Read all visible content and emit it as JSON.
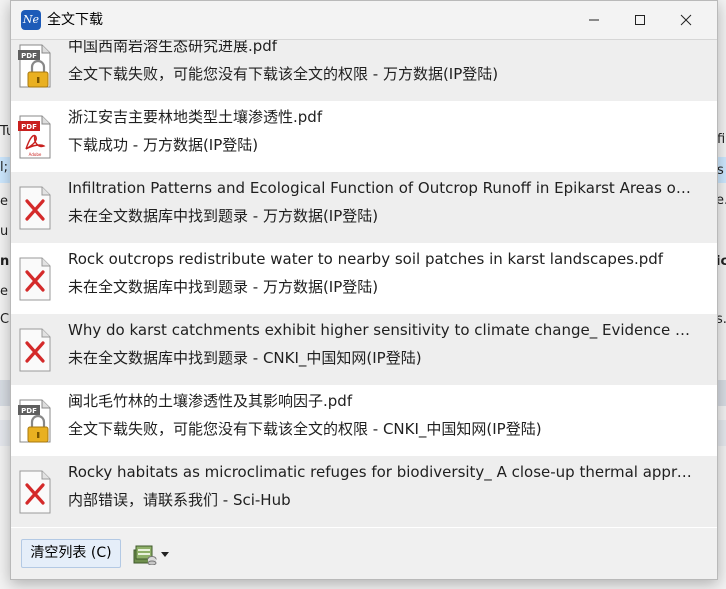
{
  "window": {
    "title": "全文下载",
    "app_icon_text": "Ne",
    "controls": [
      "minimize",
      "maximize",
      "close"
    ]
  },
  "background_fragments": [
    "Tu",
    "l;",
    "e",
    "u",
    "n",
    "e",
    "C",
    "fi",
    "s",
    "e.",
    "ic",
    "s."
  ],
  "downloads": [
    {
      "filename": "中国西南岩溶生态研究进展.pdf",
      "status": "全文下载失败，可能您没有下载该全文的权限  -  万方数据(IP登陆)",
      "icon": "pdf-lock-icon"
    },
    {
      "filename": "浙江安吉主要林地类型土壤渗透性.pdf",
      "status": "下载成功  -  万方数据(IP登陆)",
      "icon": "pdf-adobe-icon"
    },
    {
      "filename": "Infiltration Patterns and Ecological Function of Outcrop Runoff in Epikarst Areas of Southern China.pdf",
      "status": "未在全文数据库中找到题录  -  万方数据(IP登陆)",
      "icon": "failed-file-icon"
    },
    {
      "filename": "Rock outcrops redistribute water to nearby soil patches in karst landscapes.pdf",
      "status": "未在全文数据库中找到题录  -  万方数据(IP登陆)",
      "icon": "failed-file-icon"
    },
    {
      "filename": "Why do karst catchments exhibit higher sensitivity to climate change_ Evidence from a modeling study.pdf",
      "status": "未在全文数据库中找到题录  -  CNKI_中国知网(IP登陆)",
      "icon": "failed-file-icon"
    },
    {
      "filename": "闽北毛竹林的土壤渗透性及其影响因子.pdf",
      "status": "全文下载失败，可能您没有下载该全文的权限  -  CNKI_中国知网(IP登陆)",
      "icon": "pdf-lock-icon"
    },
    {
      "filename": "Rocky habitats as microclimatic refuges for biodiversity_ A close-up thermal approach.pdf",
      "status": "内部错误，请联系我们  -  Sci-Hub",
      "icon": "failed-file-icon"
    }
  ],
  "footer": {
    "clear_button_label": "清空列表 (C)",
    "tools_icon": "database-icon",
    "tools_dropdown_icon": "caret-down-icon"
  },
  "colors": {
    "row_alt": "#eeeeee",
    "button_bg": "#e5eef9",
    "button_border": "#b3c9e4",
    "app_icon": "#1e5bb8",
    "error_x": "#d42a2a"
  }
}
